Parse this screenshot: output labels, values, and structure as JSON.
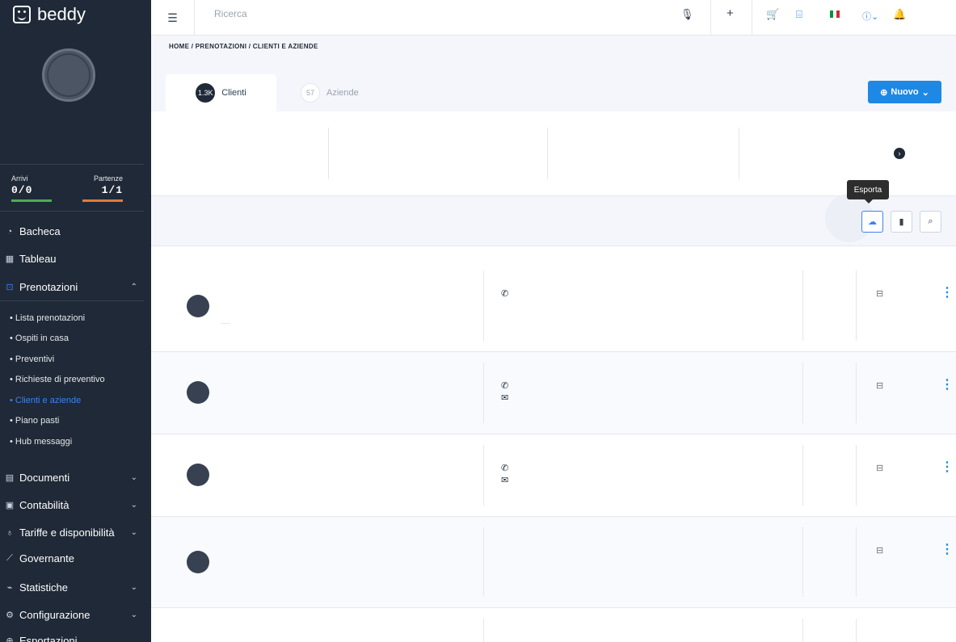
{
  "app": {
    "name": "beddy"
  },
  "sidebar": {
    "stats": [
      {
        "label": "Arrivi",
        "value": "0/0",
        "color": "#4caf50"
      },
      {
        "label": "Partenze",
        "value": "1/1",
        "color": "#e07b39"
      }
    ],
    "menu": [
      {
        "label": "Bacheca",
        "icon": "dashboard-icon"
      },
      {
        "label": "Tableau",
        "icon": "grid-icon"
      },
      {
        "label": "Prenotazioni",
        "icon": "lock-icon",
        "expanded": true
      },
      {
        "label": "Documenti",
        "icon": "document-icon"
      },
      {
        "label": "Contabilità",
        "icon": "calculator-icon"
      },
      {
        "label": "Tariffe e disponibilità",
        "icon": "bell-icon"
      },
      {
        "label": "Governante",
        "icon": "broom-icon"
      },
      {
        "label": "Statistiche",
        "icon": "chart-icon"
      },
      {
        "label": "Configurazione",
        "icon": "gear-icon"
      },
      {
        "label": "Esportazioni",
        "icon": "export-icon"
      }
    ],
    "submenu": [
      "• Lista prenotazioni",
      "• Ospiti in casa",
      "• Preventivi",
      "• Richieste di preventivo",
      "• Clienti e aziende",
      "• Piano pasti",
      "• Hub messaggi"
    ],
    "active_submenu": "• Clienti e aziende"
  },
  "topbar": {
    "search_placeholder": "Ricerca",
    "icons": [
      "menu-collapse-icon",
      "microphone-icon",
      "plus-icon",
      "cart-icon",
      "store-icon",
      "flag-it-icon",
      "help-icon",
      "bell-icon"
    ]
  },
  "breadcrumb": "HOME / PRENOTAZIONI / CLIENTI E AZIENDE",
  "tabs": [
    {
      "count": "1.3K",
      "label": "Clienti",
      "active": true
    },
    {
      "count": "57",
      "label": "Aziende",
      "active": false
    }
  ],
  "new_button": "Nuovo",
  "tooltip": "Esporta",
  "accent_color": "#1e88e5"
}
